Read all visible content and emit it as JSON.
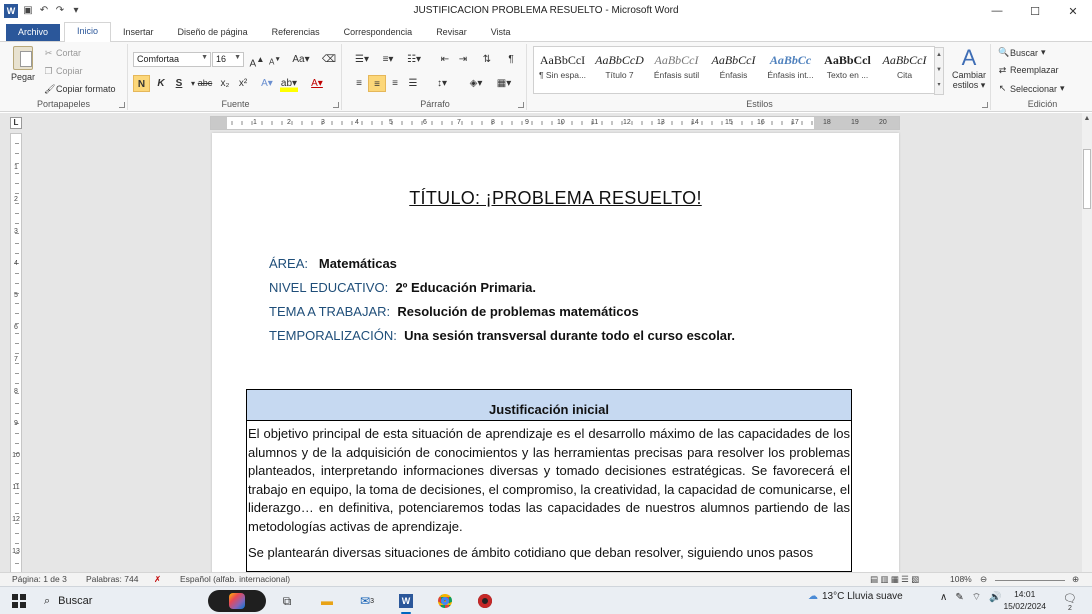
{
  "window": {
    "title": "JUSTIFICACION PROBLEMA RESUELTO  -  Microsoft Word",
    "app_icon": "W"
  },
  "tabs": [
    "Archivo",
    "Inicio",
    "Insertar",
    "Diseño de página",
    "Referencias",
    "Correspondencia",
    "Revisar",
    "Vista"
  ],
  "ribbon": {
    "clipboard": {
      "paste": "Pegar",
      "cut": "Cortar",
      "copy": "Copiar",
      "format_painter": "Copiar formato",
      "label": "Portapapeles"
    },
    "font": {
      "name": "Comfortaa",
      "size": "16",
      "bold": "N",
      "italic": "K",
      "underline": "S",
      "strike": "abc",
      "subscript": "x₂",
      "superscript": "x²",
      "grow": "A",
      "shrink": "A",
      "case": "Aa",
      "label": "Fuente"
    },
    "paragraph": {
      "label": "Párrafo"
    },
    "styles": {
      "items": [
        {
          "preview": "AaBbCcI",
          "name": "¶ Sin espa..."
        },
        {
          "preview": "AaBbCcD",
          "name": "Título 7"
        },
        {
          "preview": "AaBbCcI",
          "name": "Énfasis sutil"
        },
        {
          "preview": "AaBbCcI",
          "name": "Énfasis"
        },
        {
          "preview": "AaBbCc",
          "name": "Énfasis int..."
        },
        {
          "preview": "AaBbCcl",
          "name": "Texto en ..."
        },
        {
          "preview": "AaBbCcI",
          "name": "Cita"
        }
      ],
      "change_styles_line1": "Cambiar",
      "change_styles_line2": "estilos",
      "label": "Estilos"
    },
    "editing": {
      "find": "Buscar",
      "replace": "Reemplazar",
      "select": "Seleccionar",
      "label": "Edición"
    }
  },
  "ruler": {
    "h_numbers": [
      "1",
      "2",
      "3",
      "4",
      "5",
      "6",
      "7",
      "8",
      "9",
      "10",
      "11",
      "12",
      "13",
      "14",
      "15",
      "16",
      "17",
      "18",
      "19",
      "20"
    ],
    "v_numbers": [
      "1",
      "2",
      "3",
      "4",
      "5",
      "6",
      "7",
      "8",
      "9",
      "10",
      "11",
      "12",
      "13",
      "14"
    ]
  },
  "document": {
    "title": "TÍTULO: ¡PROBLEMA RESUELTO!",
    "meta": [
      {
        "label": "ÁREA:",
        "value": "Matemáticas"
      },
      {
        "label": "NIVEL EDUCATIVO:",
        "value": "2º Educación  Primaria."
      },
      {
        "label": "TEMA A TRABAJAR:",
        "value": "Resolución  de problemas  matemáticos"
      },
      {
        "label": "TEMPORALIZACIÓN:",
        "value": "Una sesión transversal durante todo el curso escolar."
      }
    ],
    "table_header": "Justificación  inicial",
    "paragraph1": "El objetivo principal de esta situación de aprendizaje es el desarrollo máximo de las capacidades de los alumnos y de la adquisición de conocimientos y las herramientas precisas para resolver los problemas planteados, interpretando informaciones diversas y tomado decisiones estratégicas. Se favorecerá el trabajo en equipo, la toma de decisiones, el compromiso, la creatividad, la capacidad de comunicarse, el liderazgo… en definitiva, potenciaremos todas las capacidades de nuestros alumnos partiendo de las metodologías activas de aprendizaje.",
    "paragraph2": "Se plantearán diversas situaciones de ámbito cotidiano que deban resolver, siguiendo unos pasos"
  },
  "statusbar": {
    "page": "Página: 1 de 3",
    "words": "Palabras: 744",
    "language": "Español (alfab. internacional)",
    "zoom": "108%"
  },
  "taskbar": {
    "search": "Buscar",
    "mail_badge": "3",
    "weather": "13°C  Lluvia suave",
    "time": "14:01",
    "date": "15/02/2024",
    "notifications": "2"
  }
}
